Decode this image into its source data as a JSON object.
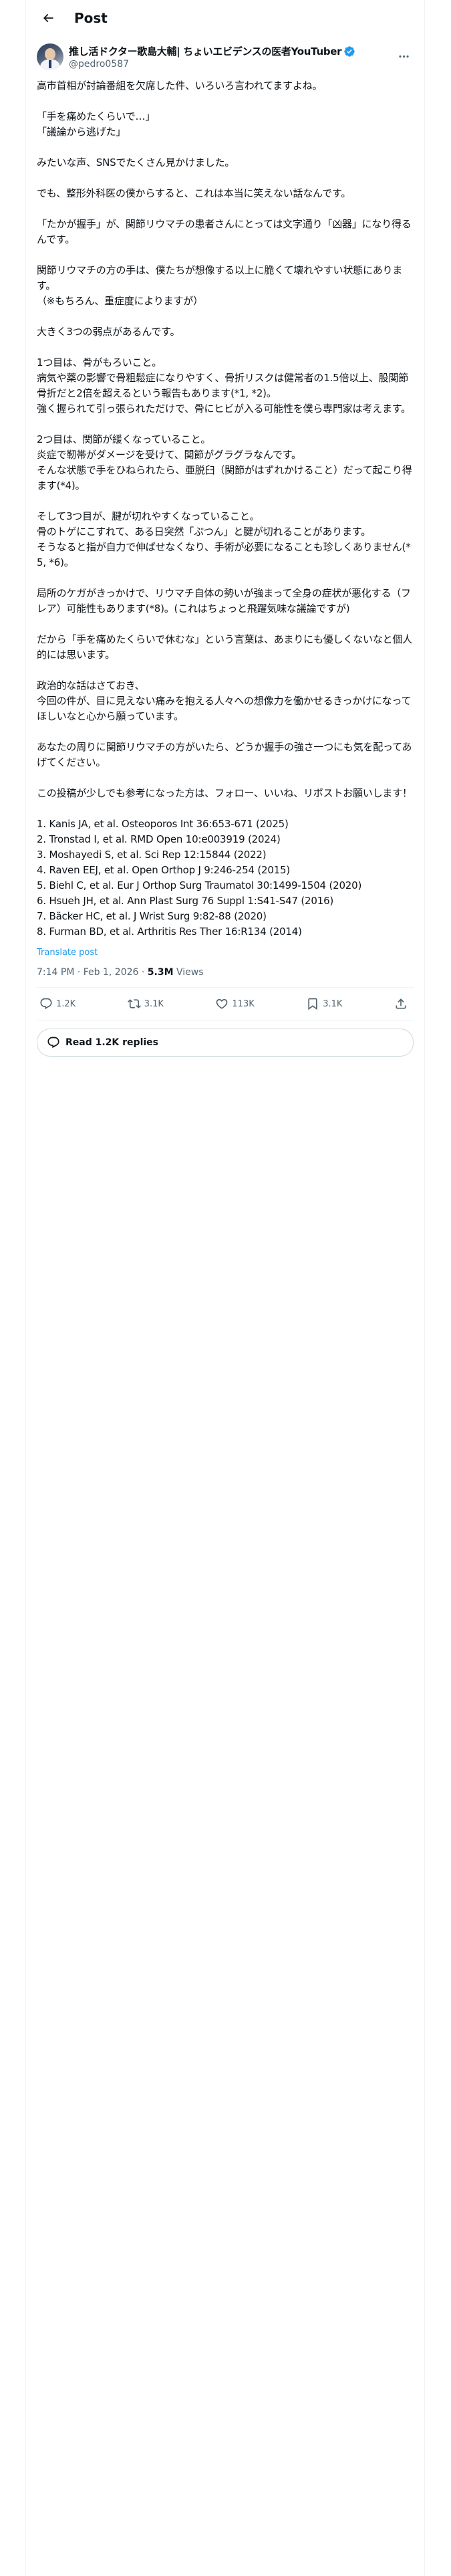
{
  "header": {
    "title": "Post"
  },
  "author": {
    "display_name": "推し活ドクター歌島大輔| ちょいエビデンスの医者YouTuber",
    "handle": "@pedro0587"
  },
  "post": {
    "body": "高市首相が討論番組を欠席した件、いろいろ言われてますよね。\n\n「手を痛めたくらいで…」\n「議論から逃げた」\n\nみたいな声、SNSでたくさん見かけました。\n\nでも、整形外科医の僕からすると、これは本当に笑えない話なんです。\n\n「たかが握手」が、関節リウマチの患者さんにとっては文字通り「凶器」になり得るんです。\n\n関節リウマチの方の手は、僕たちが想像する以上に脆くて壊れやすい状態にあります。\n（※もちろん、重症度によりますが）\n\n大きく3つの弱点があるんです。\n\n1つ目は、骨がもろいこと。\n病気や薬の影響で骨粗鬆症になりやすく、骨折リスクは健常者の1.5倍以上、股関節骨折だと2倍を超えるという報告もあります(*1, *2)。\n強く握られて引っ張られただけで、骨にヒビが入る可能性を僕ら専門家は考えます。\n\n2つ目は、関節が緩くなっていること。\n炎症で靭帯がダメージを受けて、関節がグラグラなんです。\nそんな状態で手をひねられたら、亜脱臼（関節がはずれかけること）だって起こり得ます(*4)。\n\nそして3つ目が、腱が切れやすくなっていること。\n骨のトゲにこすれて、ある日突然「ぷつん」と腱が切れることがあります。\nそうなると指が自力で伸ばせなくなり、手術が必要になることも珍しくありません(*5, *6)。\n\n局所のケガがきっかけで、リウマチ自体の勢いが強まって全身の症状が悪化する（フレア）可能性もあります(*8)。(これはちょっと飛躍気味な議論ですが)\n\nだから「手を痛めたくらいで休むな」という言葉は、あまりにも優しくないなと個人的には思います。\n\n政治的な話はさておき、\n今回の件が、目に見えない痛みを抱える人々への想像力を働かせるきっかけになってほしいなと心から願っています。\n\nあなたの周りに関節リウマチの方がいたら、どうか握手の強さ一つにも気を配ってあげてください。\n\nこの投稿が少しでも参考になった方は、フォロー、いいね、リポストお願いします！\n\n1. Kanis JA, et al. Osteoporos Int 36:653-671 (2025)\n2. Tronstad I, et al. RMD Open 10:e003919 (2024)\n3. Moshayedi S, et al. Sci Rep 12:15844 (2022)\n4. Raven EEJ, et al. Open Orthop J 9:246-254 (2015)\n5. Biehl C, et al. Eur J Orthop Surg Traumatol 30:1499-1504 (2020)\n6. Hsueh JH, et al. Ann Plast Surg 76 Suppl 1:S41-S47 (2016)\n7. Bäcker HC, et al. J Wrist Surg 9:82-88 (2020)\n8. Furman BD, et al. Arthritis Res Ther 16:R134 (2014)",
    "translate_label": "Translate post",
    "timestamp": "7:14 PM · Feb 1, 2026",
    "separator": " · ",
    "views_count": "5.3M",
    "views_label": " Views"
  },
  "actions": {
    "replies": "1.2K",
    "reposts": "3.1K",
    "likes": "113K",
    "bookmarks": "3.1K"
  },
  "read_replies_label": "Read 1.2K replies",
  "colors": {
    "accent": "#1d9bf0",
    "secondary_text": "#536471",
    "border": "#eff3f4"
  },
  "icons": [
    "back-arrow-icon",
    "verified-badge-icon",
    "more-icon",
    "reply-icon",
    "repost-icon",
    "like-icon",
    "bookmark-icon",
    "share-icon",
    "replies-bubble-icon"
  ]
}
